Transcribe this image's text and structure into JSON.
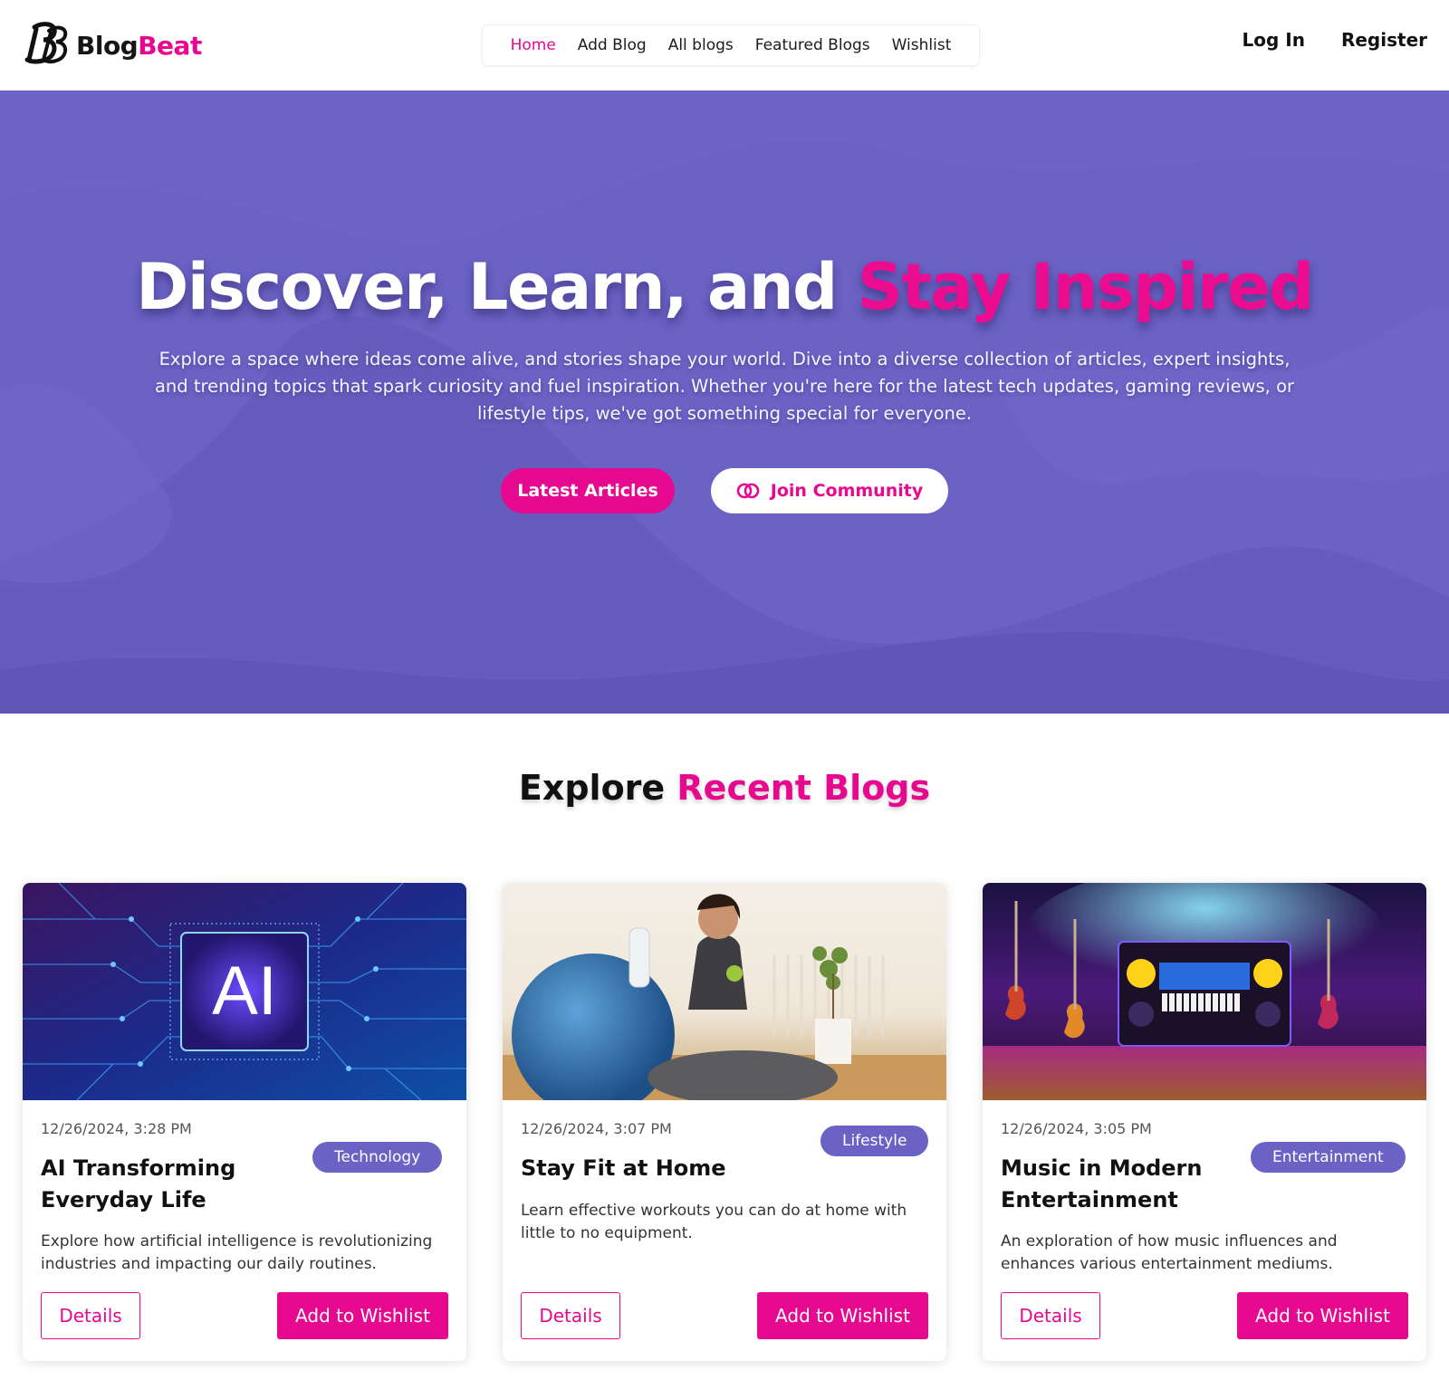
{
  "brand": {
    "name_part1": "Blog",
    "name_part2": "Beat",
    "logo_icon": "bb-monogram-logo",
    "accent_color": "#e6088e",
    "secondary_color": "#6a62c4"
  },
  "nav": {
    "links": [
      {
        "label": "Home",
        "active": true
      },
      {
        "label": "Add Blog",
        "active": false
      },
      {
        "label": "All blogs",
        "active": false
      },
      {
        "label": "Featured Blogs",
        "active": false
      },
      {
        "label": "Wishlist",
        "active": false
      }
    ],
    "login_label": "Log In",
    "register_label": "Register"
  },
  "hero": {
    "title_part1": "Discover, Learn, and ",
    "title_part2": "Stay Inspired",
    "description": "Explore a space where ideas come alive, and stories shape your world. Dive into a diverse collection of articles, expert insights, and trending topics that spark curiosity and fuel inspiration. Whether you're here for the latest tech updates, gaming reviews, or lifestyle tips, we've got something special for everyone.",
    "primary_button": "Latest Articles",
    "secondary_button": "Join Community",
    "secondary_button_icon": "interlocking-rings-icon"
  },
  "section": {
    "title_part1": "Explore ",
    "title_part2": "Recent Blogs"
  },
  "blogs": [
    {
      "date": "12/26/2024, 3:28 PM",
      "category": "Technology",
      "title": "AI Transforming Everyday Life",
      "description": "Explore how artificial intelligence is revolutionizing industries and impacting our daily routines.",
      "image_label": "AI",
      "details_label": "Details",
      "wishlist_label": "Add to Wishlist"
    },
    {
      "date": "12/26/2024, 3:07 PM",
      "category": "Lifestyle",
      "title": "Stay Fit at Home",
      "description": "Learn effective workouts you can do at home with little to no equipment.",
      "details_label": "Details",
      "wishlist_label": "Add to Wishlist"
    },
    {
      "date": "12/26/2024, 3:05 PM",
      "category": "Entertainment",
      "title": "Music in Modern Entertainment",
      "description": "An exploration of how music influences and enhances various entertainment mediums.",
      "details_label": "Details",
      "wishlist_label": "Add to Wishlist"
    }
  ]
}
